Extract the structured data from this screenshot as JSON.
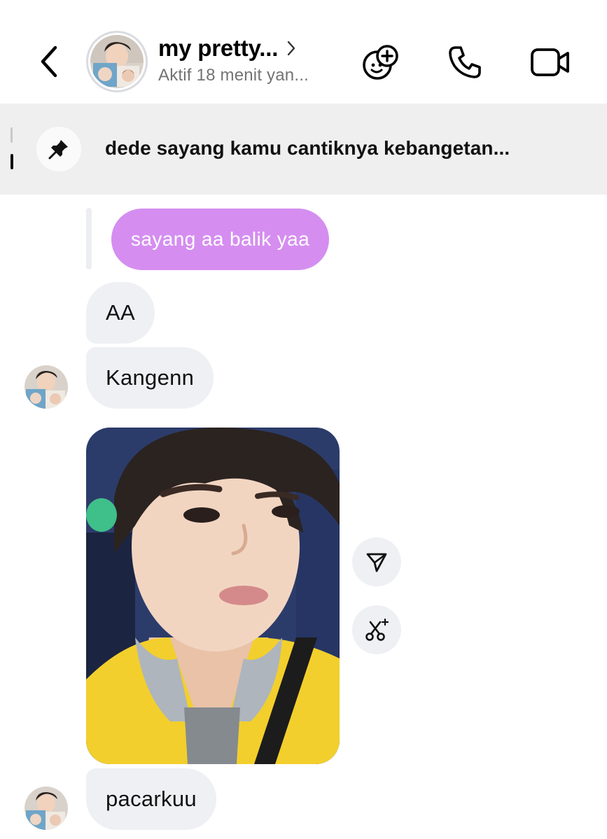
{
  "header": {
    "title": "my pretty...",
    "subtitle": "Aktif 18 menit yan...",
    "icons": [
      "back-chevron-icon",
      "chevron-right-icon",
      "add-sticker-icon",
      "phone-icon",
      "video-camera-icon"
    ]
  },
  "pinned": {
    "text": "dede sayang kamu cantiknya kebangetan...",
    "icon": "pin-icon"
  },
  "messages": [
    {
      "type": "reply",
      "sender": "me",
      "text": "sayang aa balik yaa"
    },
    {
      "type": "text",
      "sender": "them",
      "text": "AA"
    },
    {
      "type": "text",
      "sender": "them",
      "text": "Kangenn"
    },
    {
      "type": "photo",
      "sender": "them",
      "actions": [
        "share-icon",
        "cutout-icon"
      ]
    },
    {
      "type": "text",
      "sender": "them",
      "text": "pacarkuu"
    }
  ],
  "colors": {
    "my_bubble": "#d58ef0",
    "their_bubble": "#eff0f3",
    "pinned_bg": "#efefef",
    "secondary_text": "#737373"
  }
}
